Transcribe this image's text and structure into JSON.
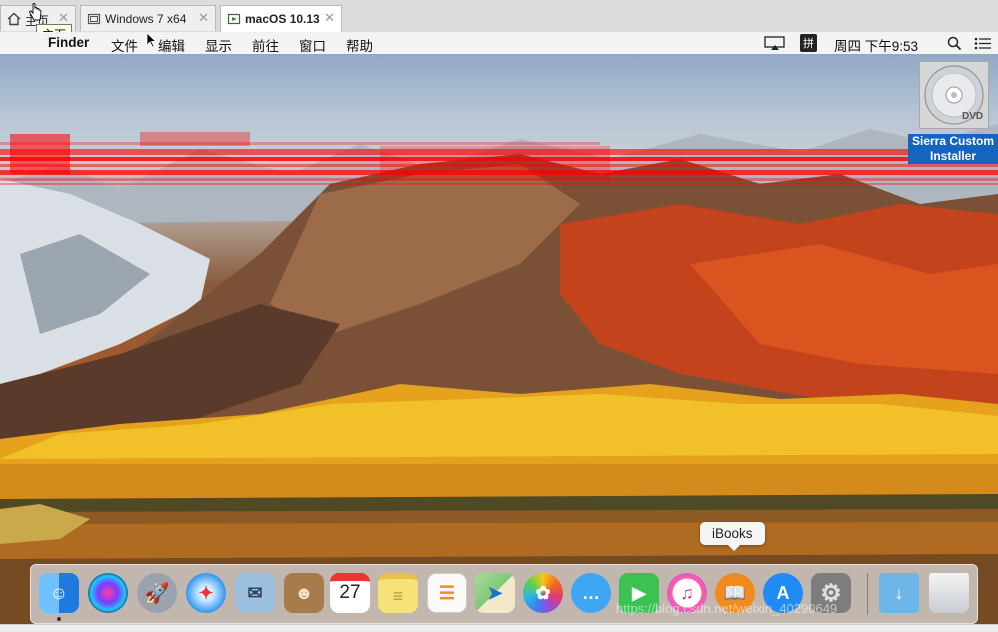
{
  "tabs": [
    {
      "label": "主页",
      "icon": "home-icon",
      "active": false
    },
    {
      "label": "Windows 7 x64",
      "icon": "vm-icon",
      "active": false
    },
    {
      "label": "macOS 10.13",
      "icon": "vm-running-icon",
      "active": true
    }
  ],
  "tab_close_glyph": "✕",
  "tooltip_text": "主页",
  "menubar": {
    "apple_glyph": "",
    "app_name": "Finder",
    "items": [
      "文件",
      "编辑",
      "显示",
      "前往",
      "窗口",
      "帮助"
    ],
    "ime": "拼",
    "clock": "周四 下午9:53"
  },
  "desktop": {
    "dvd_label": "Sierra Custom Installer",
    "dvd_text": "DVD"
  },
  "dock": {
    "tooltip": "iBooks",
    "apps": [
      {
        "name": "Finder",
        "icon": "finder-icon",
        "color": "#2a86e6",
        "glyph": "☺"
      },
      {
        "name": "Siri",
        "icon": "siri-icon",
        "color": "#2b2b7a",
        "glyph": ""
      },
      {
        "name": "Launchpad",
        "icon": "launchpad-icon",
        "color": "#9aa3ad",
        "glyph": "🚀"
      },
      {
        "name": "Safari",
        "icon": "safari-icon",
        "color": "#1e8cf0",
        "glyph": "✦"
      },
      {
        "name": "Mail",
        "icon": "mail-icon",
        "color": "#9bc0e0",
        "glyph": "✉"
      },
      {
        "name": "Contacts",
        "icon": "contacts-icon",
        "color": "#a77b4a",
        "glyph": "☻"
      },
      {
        "name": "Calendar",
        "icon": "calendar-icon",
        "color": "#ffffff",
        "glyph": "27"
      },
      {
        "name": "Notes",
        "icon": "notes-icon",
        "color": "#f7e27a",
        "glyph": "≡"
      },
      {
        "name": "Reminders",
        "icon": "reminders-icon",
        "color": "#fafafa",
        "glyph": "☰"
      },
      {
        "name": "Maps",
        "icon": "maps-icon",
        "color": "#7fc77a",
        "glyph": "➤"
      },
      {
        "name": "Photos",
        "icon": "photos-icon",
        "color": "#ffffff",
        "glyph": "✿"
      },
      {
        "name": "Messages",
        "icon": "messages-icon",
        "color": "#3ea7f5",
        "glyph": "…"
      },
      {
        "name": "FaceTime",
        "icon": "facetime-icon",
        "color": "#3cc153",
        "glyph": "▶"
      },
      {
        "name": "iTunes",
        "icon": "itunes-icon",
        "color": "#e84a8c",
        "glyph": "♫"
      },
      {
        "name": "iBooks",
        "icon": "ibooks-icon",
        "color": "#f08c1e",
        "glyph": "📖"
      },
      {
        "name": "App Store",
        "icon": "appstore-icon",
        "color": "#1f8cf5",
        "glyph": "A"
      },
      {
        "name": "System Preferences",
        "icon": "system-preferences-icon",
        "color": "#7d7d7d",
        "glyph": "⚙"
      },
      {
        "name": "Downloads",
        "icon": "downloads-folder-icon",
        "color": "#6db6e8",
        "glyph": "↓"
      },
      {
        "name": "Trash",
        "icon": "trash-icon",
        "color": "#e4e6e8",
        "glyph": ""
      }
    ]
  },
  "watermark": "https://blog.csdn.net/weixin_40290649"
}
